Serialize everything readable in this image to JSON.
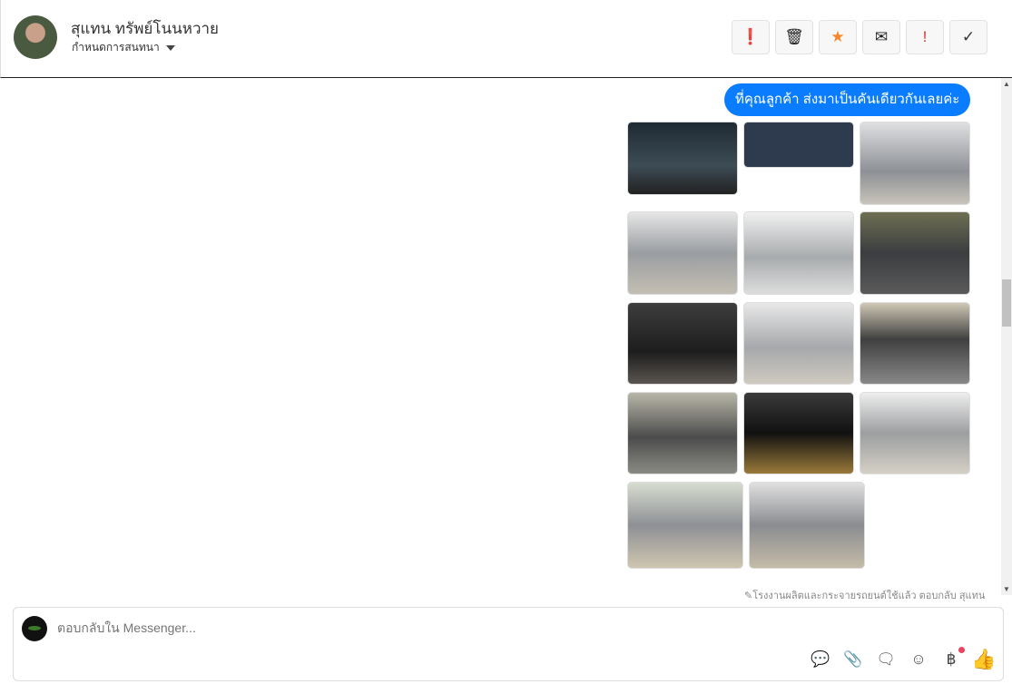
{
  "header": {
    "contact_name": "สุแทน ทรัพย์โนนหวาย",
    "subtitle": "กำหนดการสนทนา"
  },
  "actions": [
    {
      "name": "report-icon",
      "glyph": "❗",
      "color": "#222"
    },
    {
      "name": "trash-icon",
      "glyph": "🗑",
      "color": "#222"
    },
    {
      "name": "star-icon",
      "glyph": "★",
      "color": "#f5862a"
    },
    {
      "name": "mail-icon",
      "glyph": "✉",
      "color": "#222"
    },
    {
      "name": "important-icon",
      "glyph": "!",
      "color": "#d9342b"
    },
    {
      "name": "check-icon",
      "glyph": "✓",
      "color": "#333"
    }
  ],
  "message": {
    "text": "ที่คุณลูกค้า ส่งมาเป็นคันเดียวกันเลยค่ะ",
    "bubble_color": "#0a7cff"
  },
  "images": [
    "dashboard",
    "vehicle-info-document",
    "front-view",
    "front-three-quarter",
    "side-view",
    "rear-seats",
    "gear-shift",
    "rear-three-quarter",
    "steering-wheel",
    "interior-driver",
    "wheel",
    "rear-view",
    "rear-three-quarter-2",
    "front-three-quarter-2"
  ],
  "footnote": "โรงงานผลิตและกระจายรถยนต์ใช้แล้ว ตอบกลับ สุแทน",
  "composer": {
    "placeholder": "ตอบกลับใน Messenger..."
  }
}
